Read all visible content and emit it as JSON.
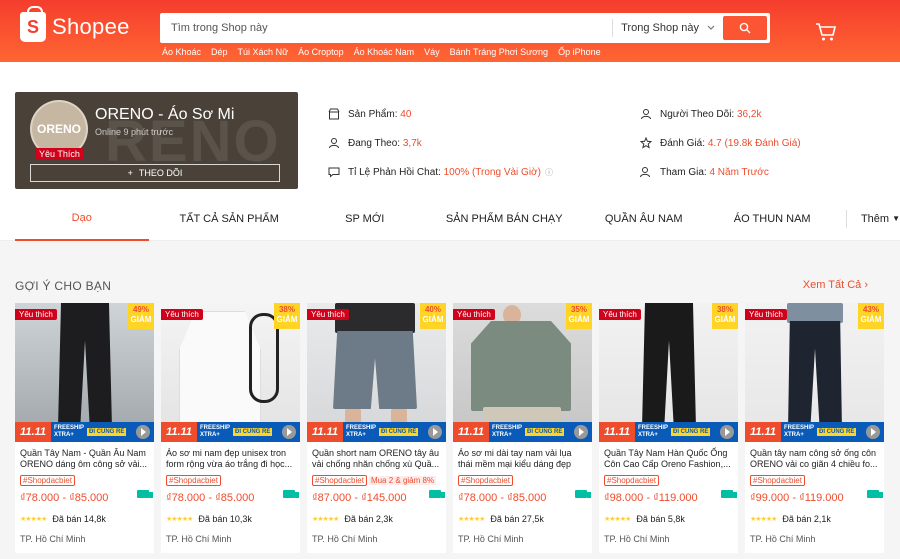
{
  "header": {
    "logo_text": "Shopee",
    "search_placeholder": "Tìm trong Shop này",
    "search_scope": "Trong Shop này",
    "keywords": [
      "Áo Khoác",
      "Dép",
      "Túi Xách Nữ",
      "Áo Croptop",
      "Áo Khoác Nam",
      "Váy",
      "Bánh Tráng Phơi Sương",
      "Ốp iPhone"
    ]
  },
  "shop": {
    "logo_text": "ORENO",
    "name": "ORENO - Áo Sơ Mi",
    "status": "Online 9 phút trước",
    "fav_badge": "Yêu Thích",
    "follow_label": "THEO DÕI",
    "stats": {
      "products_label": "Sản Phẩm:",
      "products_value": "40",
      "following_label": "Đang Theo:",
      "following_value": "3,7k",
      "chat_label": "Tỉ Lệ Phản Hồi Chat:",
      "chat_value": "100% (Trong Vài Giờ)",
      "followers_label": "Người Theo Dõi:",
      "followers_value": "36,2k",
      "rating_label": "Đánh Giá:",
      "rating_value": "4.7 (19.8k Đánh Giá)",
      "joined_label": "Tham Gia:",
      "joined_value": "4 Năm Trước"
    }
  },
  "tabs": [
    "Dạo",
    "TẤT CẢ SẢN PHẨM",
    "SP MỚI",
    "SẢN PHẨM BÁN CHẠY",
    "QUẦN ÂU NAM",
    "ÁO THUN NAM"
  ],
  "tab_more": "Thêm",
  "recommend": {
    "title": "GỢI Ý CHO BẠN",
    "see_all": "Xem Tất Cả"
  },
  "products": [
    {
      "name": "Quần Tây Nam - Quần Âu Nam ORENO dáng ôm công sở vải...",
      "tag": "#Shopdacbiet",
      "tag2": "",
      "price": "₫78.000 - ₫85.000",
      "sold": "Đã bán 14,8k",
      "location": "TP. Hồ Chí Minh",
      "discount": "49%",
      "discount_label": "GIẢM",
      "badge": "Yêu thích"
    },
    {
      "name": "Áo sơ mi nam đẹp unisex tron form rộng vừa áo trắng đi học...",
      "tag": "#Shopdacbiet",
      "tag2": "",
      "price": "₫78.000 - ₫85.000",
      "sold": "Đã bán 10,3k",
      "location": "TP. Hồ Chí Minh",
      "discount": "38%",
      "discount_label": "GIẢM",
      "badge": "Yêu thích"
    },
    {
      "name": "Quần short nam ORENO tây âu vải chống nhăn chống xù Quầ...",
      "tag": "#Shopdacbiet",
      "tag2": "Mua 2 & giảm 8%",
      "price": "₫87.000 - ₫145.000",
      "sold": "Đã bán 2,3k",
      "location": "TP. Hồ Chí Minh",
      "discount": "40%",
      "discount_label": "GIẢM",
      "badge": "Yêu thích"
    },
    {
      "name": "Áo sơ mi dài tay nam vải lụa thái mềm mại kiểu dáng đẹp phon...",
      "tag": "#Shopdacbiet",
      "tag2": "",
      "price": "₫78.000 - ₫85.000",
      "sold": "Đã bán 27,5k",
      "location": "TP. Hồ Chí Minh",
      "discount": "35%",
      "discount_label": "GIẢM",
      "badge": "Yêu thích"
    },
    {
      "name": "Quần Tây Nam Hàn Quốc Ống Côn Cao Cấp Oreno Fashion,...",
      "tag": "#Shopdacbiet",
      "tag2": "",
      "price": "₫98.000 - ₫119.000",
      "sold": "Đã bán 5,8k",
      "location": "TP. Hồ Chí Minh",
      "discount": "38%",
      "discount_label": "GIẢM",
      "badge": "Yêu thích"
    },
    {
      "name": "Quần tây nam công sở ống côn ORENO vải co giãn 4 chiều fo...",
      "tag": "#Shopdacbiet",
      "tag2": "",
      "price": "₫99.000 - ₫119.000",
      "sold": "Đã bán 2,1k",
      "location": "TP. Hồ Chí Minh",
      "discount": "43%",
      "discount_label": "GIẢM",
      "badge": "Yêu thích"
    }
  ],
  "promo": {
    "big": "11.11",
    "freeship": "FREESHIP",
    "xtra": "XTRA+",
    "dicung": "ĐI CÙNG RẺ"
  },
  "colors": {
    "brand": "#ee4d2d",
    "header_start": "#f53d2d",
    "header_end": "#ff6633"
  }
}
